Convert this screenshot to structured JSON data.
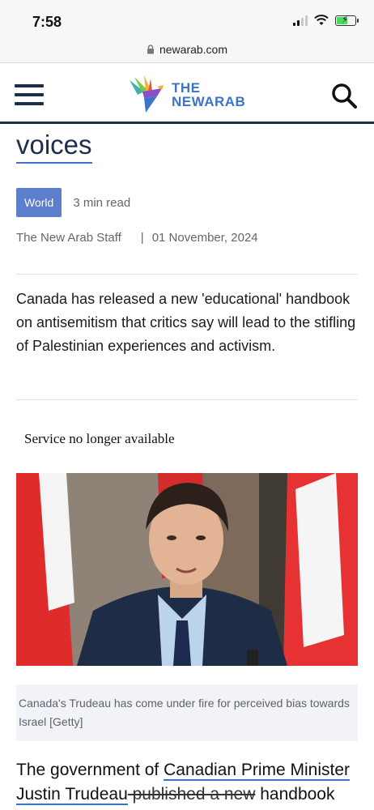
{
  "status_bar": {
    "time": "7:58"
  },
  "browser": {
    "url": "newarab.com"
  },
  "header": {
    "logo_line1": "THE",
    "logo_line2": "NEWARAB"
  },
  "article": {
    "headline_tail": "voices",
    "category": "World",
    "read_time": "3 min read",
    "author": "The New Arab Staff",
    "separator": "|",
    "date": "01 November, 2024",
    "standfirst": "Canada has released a new 'educational' handbook on antisemitism that critics say will lead to the stifling of Palestinian experiences and activism.",
    "service_message": "Service no longer available",
    "caption": "Canada's Trudeau has come under fire for perceived bias towards Israel [Getty]",
    "body_intro": "The government of ",
    "body_link": "Canadian Prime Minister Justin Trudeau",
    "body_strike": " published a new",
    "body_tail": " handbook"
  },
  "colors": {
    "navy": "#1e2d4a",
    "accent_blue": "#3b74c9",
    "tag_blue": "#5b7fcc"
  },
  "icons": {
    "lock": "lock-icon",
    "menu": "hamburger-menu-icon",
    "search": "search-icon",
    "logo": "bird-logo-icon"
  }
}
